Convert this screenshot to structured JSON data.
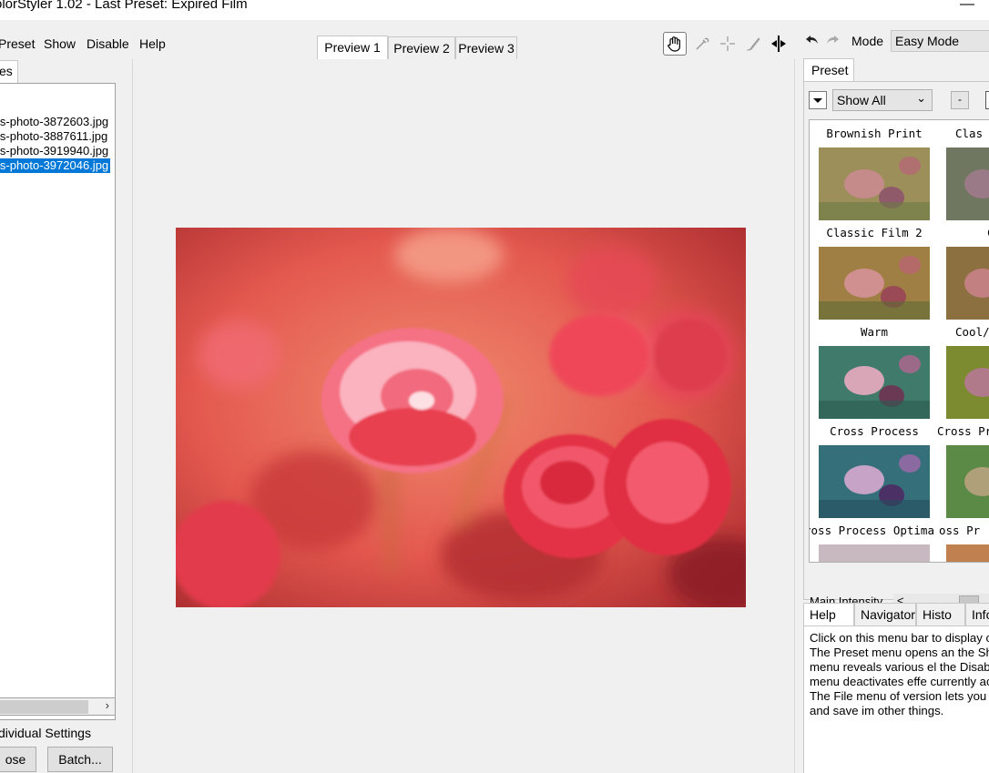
{
  "window": {
    "title": "olorStyler 1.02 - Last Preset: Expired Film",
    "minimize_glyph": "—"
  },
  "menu": {
    "preset": "Preset",
    "show": "Show",
    "disable": "Disable",
    "help": "Help"
  },
  "left": {
    "tab_label": "es",
    "files": [
      "ls-photo-3872603.jpg",
      "ls-photo-3887611.jpg",
      "ls-photo-3919940.jpg",
      "ls-photo-3972046.jpg"
    ],
    "selected_index": 3,
    "scroll_right_glyph": "›",
    "individual_settings": "dividual Settings",
    "close_button": "ose",
    "batch_button": "Batch..."
  },
  "preview_tabs": [
    "Preview 1",
    "Preview 2",
    "Preview 3"
  ],
  "active_preview_tab": 0,
  "tools": [
    "hand-icon",
    "eyedropper-icon",
    "crosshair-icon",
    "brush-icon",
    "split-view-icon"
  ],
  "mode": {
    "label": "Mode",
    "value": "Easy Mode"
  },
  "preset_panel": {
    "tab_label": "Preset",
    "filter_value": "Show All",
    "minus_label": "-",
    "items": [
      "Brownish Print",
      "Clas",
      "Classic Film 2",
      "C",
      "Warm",
      "Cool/",
      "Cross Process",
      "Cross Pr",
      "ross Process Optima",
      "oss Pr"
    ],
    "intensity_label": "Main Intensity"
  },
  "help_panel": {
    "tabs": [
      "Help",
      "Navigator",
      "Histo",
      "Info"
    ],
    "active_tab": 0,
    "text": "Click on this menu bar to display c items. The Preset menu opens an the Show menu reveals various el the Disable menu deactivates effe currently active. The File menu of version lets you open and save im other things."
  },
  "colors": {
    "selection": "#0078d7",
    "panel_bg": "#f0f0f0",
    "photo_base": "#e2584f"
  }
}
